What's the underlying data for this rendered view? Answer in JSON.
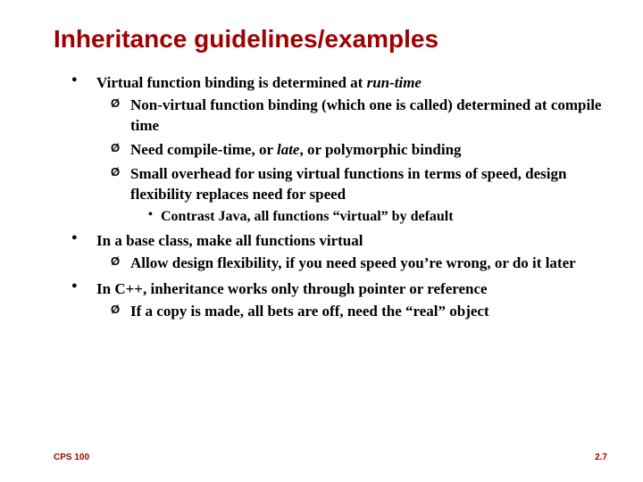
{
  "title": "Inheritance guidelines/examples",
  "b1": {
    "lead": "Virtual function binding is determined at ",
    "em": "run-time",
    "s1": "Non-virtual function binding (which one is called) determined at compile time",
    "s2a": "Need compile-time, or ",
    "s2em": "late",
    "s2b": ", or polymorphic binding",
    "s3": "Small overhead for using virtual functions in terms of speed, design flexibility replaces need for speed",
    "s3d1": "Contrast Java, all functions “virtual” by default"
  },
  "b2": {
    "lead": "In a base class, make all functions virtual",
    "s1": "Allow design flexibility, if you need speed you’re wrong, or do it later"
  },
  "b3": {
    "lead": "In C++, inheritance works only through pointer or reference",
    "s1": "If a copy is made, all bets are off, need the “real” object"
  },
  "footer": {
    "left": "CPS 100",
    "right": "2.7"
  }
}
